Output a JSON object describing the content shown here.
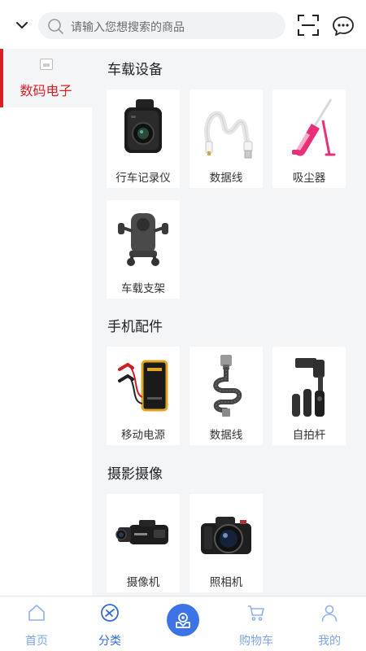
{
  "header": {
    "search_placeholder": "请输入您想搜索的商品",
    "icons": [
      "chevron-down-icon",
      "search-icon",
      "scan-icon",
      "message-icon"
    ]
  },
  "sidebar": {
    "items": [
      {
        "label": "数码电子",
        "active": true
      }
    ]
  },
  "sections": [
    {
      "title": "车载设备",
      "items": [
        {
          "name": "行车记录仪",
          "icon": "dashcam"
        },
        {
          "name": "数据线",
          "icon": "usb-cable-white"
        },
        {
          "name": "吸尘器",
          "icon": "vacuum"
        },
        {
          "name": "车载支架",
          "icon": "phone-mount"
        }
      ]
    },
    {
      "title": "手机配件",
      "items": [
        {
          "name": "移动电源",
          "icon": "jump-starter"
        },
        {
          "name": "数据线",
          "icon": "usb-cable-braided"
        },
        {
          "name": "自拍杆",
          "icon": "gimbal"
        }
      ]
    },
    {
      "title": "摄影摄像",
      "items": [
        {
          "name": "摄像机",
          "icon": "camcorder"
        },
        {
          "name": "照相机",
          "icon": "camera"
        }
      ]
    }
  ],
  "bottom_nav": {
    "items": [
      {
        "label": "首页",
        "icon": "home-icon"
      },
      {
        "label": "分类",
        "icon": "category-icon",
        "active": true
      },
      {
        "label": "",
        "icon": "center-action-icon"
      },
      {
        "label": "购物车",
        "icon": "cart-icon"
      },
      {
        "label": "我的",
        "icon": "user-icon"
      }
    ]
  },
  "colors": {
    "accent_red": "#d71f26",
    "nav_blue": "#3569d8",
    "nav_light_blue": "#7da4ea",
    "background": "#f4f5f7"
  }
}
